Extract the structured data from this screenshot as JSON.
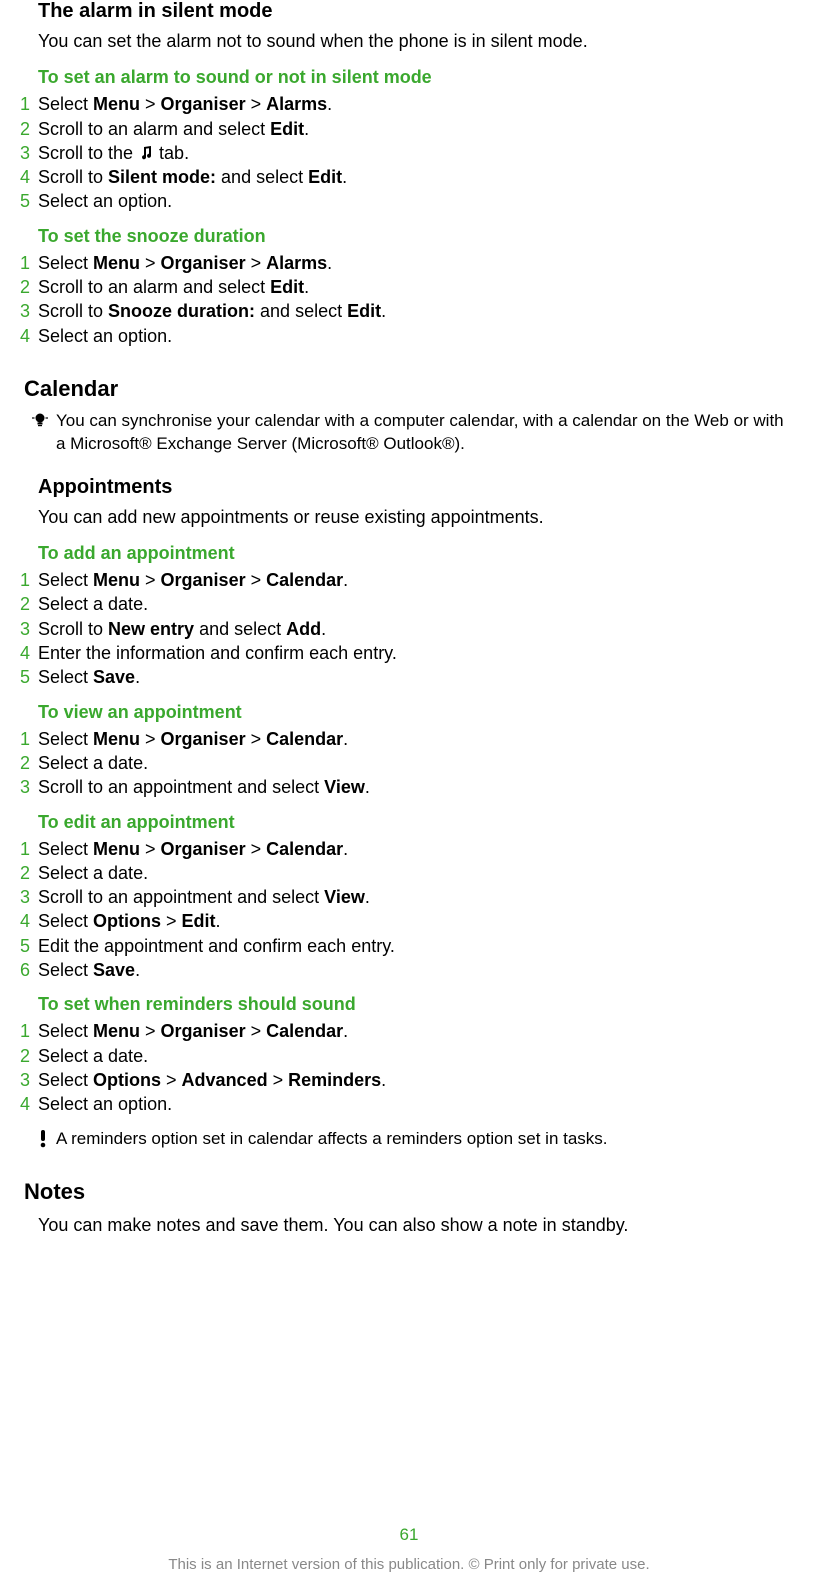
{
  "alarm_silent": {
    "heading": "The alarm in silent mode",
    "body": "You can set the alarm not to sound when the phone is in silent mode."
  },
  "task_silent": {
    "title": "To set an alarm to sound or not in silent mode",
    "steps": {
      "s1_pre": "Select ",
      "s1_b1": "Menu",
      "s1_gt1": " > ",
      "s1_b2": "Organiser",
      "s1_gt2": " > ",
      "s1_b3": "Alarms",
      "s1_end": ".",
      "s2_pre": "Scroll to an alarm and select ",
      "s2_b": "Edit",
      "s2_end": ".",
      "s3_pre": "Scroll to the ",
      "s3_post": " tab.",
      "s4_pre": "Scroll to ",
      "s4_b1": "Silent mode:",
      "s4_mid": " and select ",
      "s4_b2": "Edit",
      "s4_end": ".",
      "s5": "Select an option."
    }
  },
  "task_snooze": {
    "title": "To set the snooze duration",
    "steps": {
      "s1_pre": "Select ",
      "s1_b1": "Menu",
      "s1_gt1": " > ",
      "s1_b2": "Organiser",
      "s1_gt2": " > ",
      "s1_b3": "Alarms",
      "s1_end": ".",
      "s2_pre": "Scroll to an alarm and select ",
      "s2_b": "Edit",
      "s2_end": ".",
      "s3_pre": "Scroll to ",
      "s3_b1": "Snooze duration:",
      "s3_mid": " and select ",
      "s3_b2": "Edit",
      "s3_end": ".",
      "s4": "Select an option."
    }
  },
  "calendar": {
    "heading": "Calendar",
    "tip": "You can synchronise your calendar with a computer calendar, with a calendar on the Web or with a Microsoft® Exchange Server (Microsoft® Outlook®)."
  },
  "appointments": {
    "heading": "Appointments",
    "body": "You can add new appointments or reuse existing appointments."
  },
  "task_add_appt": {
    "title": "To add an appointment",
    "steps": {
      "s1_pre": "Select ",
      "s1_b1": "Menu",
      "s1_gt1": " > ",
      "s1_b2": "Organiser",
      "s1_gt2": " > ",
      "s1_b3": "Calendar",
      "s1_end": ".",
      "s2": "Select a date.",
      "s3_pre": "Scroll to ",
      "s3_b1": "New entry",
      "s3_mid": " and select ",
      "s3_b2": "Add",
      "s3_end": ".",
      "s4": "Enter the information and confirm each entry.",
      "s5_pre": "Select ",
      "s5_b": "Save",
      "s5_end": "."
    }
  },
  "task_view_appt": {
    "title": "To view an appointment",
    "steps": {
      "s1_pre": "Select ",
      "s1_b1": "Menu",
      "s1_gt1": " > ",
      "s1_b2": "Organiser",
      "s1_gt2": " > ",
      "s1_b3": "Calendar",
      "s1_end": ".",
      "s2": "Select a date.",
      "s3_pre": "Scroll to an appointment and select ",
      "s3_b": "View",
      "s3_end": "."
    }
  },
  "task_edit_appt": {
    "title": "To edit an appointment",
    "steps": {
      "s1_pre": "Select ",
      "s1_b1": "Menu",
      "s1_gt1": " > ",
      "s1_b2": "Organiser",
      "s1_gt2": " > ",
      "s1_b3": "Calendar",
      "s1_end": ".",
      "s2": "Select a date.",
      "s3_pre": "Scroll to an appointment and select ",
      "s3_b": "View",
      "s3_end": ".",
      "s4_pre": "Select ",
      "s4_b1": "Options",
      "s4_gt": " > ",
      "s4_b2": "Edit",
      "s4_end": ".",
      "s5": "Edit the appointment and confirm each entry.",
      "s6_pre": "Select ",
      "s6_b": "Save",
      "s6_end": "."
    }
  },
  "task_reminders": {
    "title": "To set when reminders should sound",
    "steps": {
      "s1_pre": "Select ",
      "s1_b1": "Menu",
      "s1_gt1": " > ",
      "s1_b2": "Organiser",
      "s1_gt2": " > ",
      "s1_b3": "Calendar",
      "s1_end": ".",
      "s2": "Select a date.",
      "s3_pre": "Select ",
      "s3_b1": "Options",
      "s3_gt1": " > ",
      "s3_b2": "Advanced",
      "s3_gt2": " > ",
      "s3_b3": "Reminders",
      "s3_end": ".",
      "s4": "Select an option."
    },
    "warning": "A reminders option set in calendar affects a reminders option set in tasks."
  },
  "notes": {
    "heading": "Notes",
    "body": "You can make notes and save them. You can also show a note in standby."
  },
  "page_number": "61",
  "footer": "This is an Internet version of this publication. © Print only for private use.",
  "step_labels": {
    "n1": "1",
    "n2": "2",
    "n3": "3",
    "n4": "4",
    "n5": "5",
    "n6": "6"
  }
}
